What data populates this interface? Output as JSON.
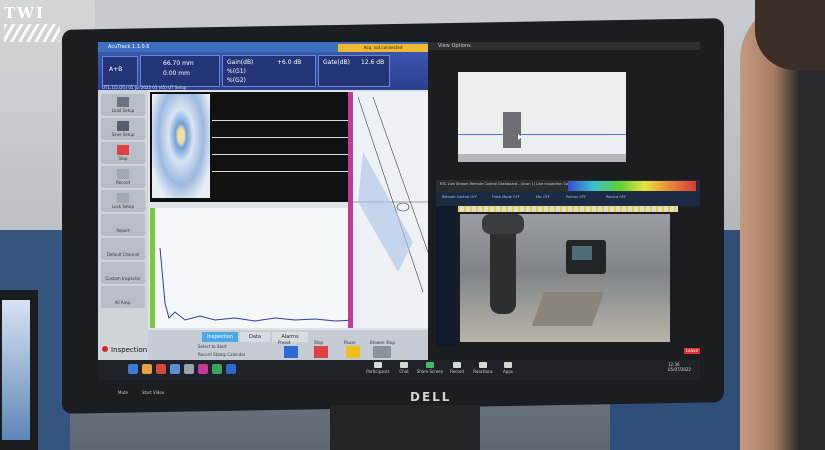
{
  "logo": {
    "text": "TWI"
  },
  "monitor": {
    "brand": "DELL"
  },
  "app": {
    "title": "AcuTrack 1.1.0.6",
    "toolbar": {
      "scan_label": "A+B",
      "gain_db": "+6.0 dB",
      "gate_db": "12.6 dB",
      "pos1": "66.70 mm",
      "pos2": "0.00 mm",
      "gain_label": "Gain(dB)",
      "gate_label": "Gate(dB)",
      "probe_label": "%(G1)",
      "probe2_label": "%(G2)",
      "file_info": "UT1.1(5.0/5) 05 Jul 2022 05 (45) UT Setup",
      "warning": "Acq. not connected"
    },
    "left_panel": [
      "Load Setup",
      "Save Setup",
      "Stop",
      "Record",
      "Lock Setup",
      "Report",
      "Default Channel",
      "Custom Inspector",
      "All Amp."
    ],
    "tabs": [
      {
        "label": "Inspection",
        "active": true
      },
      {
        "label": "Data",
        "active": false
      },
      {
        "label": "Alarms",
        "active": false
      }
    ],
    "inspection_label": "Inspection",
    "bottom_buttons": [
      "Select to Start",
      "Record Stamp Calendar",
      "Preset",
      "Stop",
      "Pause",
      "Browse Stop"
    ]
  },
  "viewer": {
    "title": "View Options",
    "cam_title": "RTC Live Stream Remote Control Dashboard - (Scan 1) Live Inspection Camera Snapshot",
    "cam_toolbar": [
      "Remote Control OFF",
      "Flash Mode OFF",
      "Mic OFF",
      "Pointer OFF",
      "Record OFF"
    ]
  },
  "taskbar": {
    "left_items": [
      "Mute",
      "Start Video"
    ],
    "meeting_items": [
      "Participants",
      "Chat",
      "Share Screen",
      "Record",
      "Reactions",
      "Apps"
    ],
    "clock": "12:36",
    "date": "05/07/2022",
    "leave": "Leave"
  },
  "colors": {
    "toolbar": "#2b3f8f",
    "tab_active": "#4aa8e8",
    "stop_red": "#e04040",
    "pause_yellow": "#f0c020",
    "robot": "#2d2e30"
  }
}
